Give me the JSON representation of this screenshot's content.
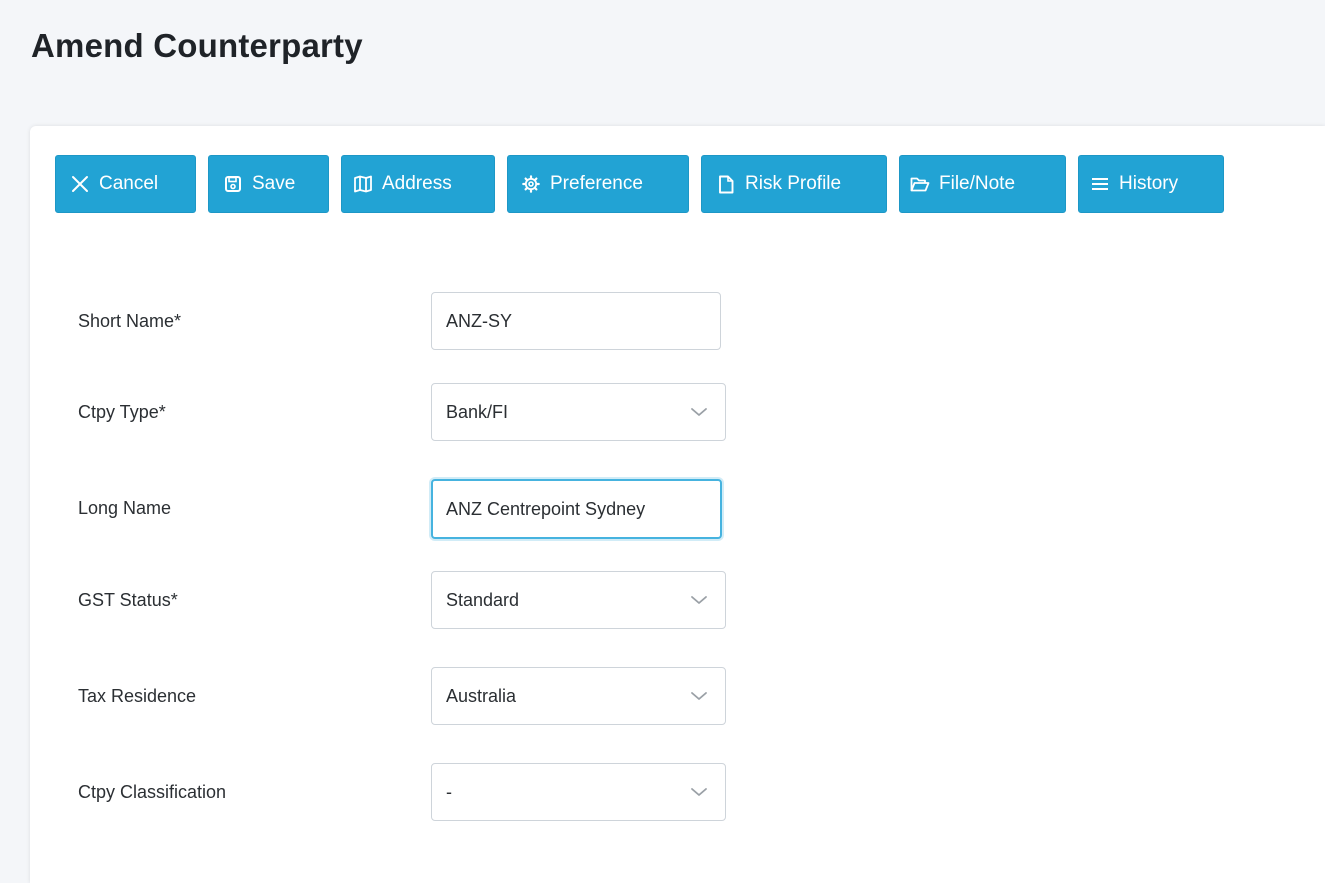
{
  "page": {
    "title": "Amend Counterparty"
  },
  "toolbar": {
    "buttons": [
      {
        "label": "Cancel",
        "icon": "close-icon"
      },
      {
        "label": "Save",
        "icon": "floppy-disk-icon"
      },
      {
        "label": "Address",
        "icon": "map-icon"
      },
      {
        "label": "Preference",
        "icon": "gear-icon"
      },
      {
        "label": "Risk Profile",
        "icon": "file-icon"
      },
      {
        "label": "File/Note",
        "icon": "folder-open-icon"
      },
      {
        "label": "History",
        "icon": "list-icon"
      }
    ]
  },
  "form": {
    "short_name": {
      "label": "Short Name*",
      "value": "ANZ-SY"
    },
    "ctpy_type": {
      "label": "Ctpy Type*",
      "value": "Bank/FI"
    },
    "long_name": {
      "label": "Long Name",
      "value": "ANZ Centrepoint Sydney"
    },
    "gst_status": {
      "label": "GST Status*",
      "value": "Standard"
    },
    "tax_residence": {
      "label": "Tax Residence",
      "value": "Australia"
    },
    "ctpy_classification": {
      "label": "Ctpy Classification",
      "value": "-"
    }
  },
  "colors": {
    "button_bg": "#22a3d4",
    "button_text": "#ffffff",
    "page_bg": "#f4f6f9",
    "card_bg": "#ffffff",
    "focus_border": "#46b3df"
  }
}
